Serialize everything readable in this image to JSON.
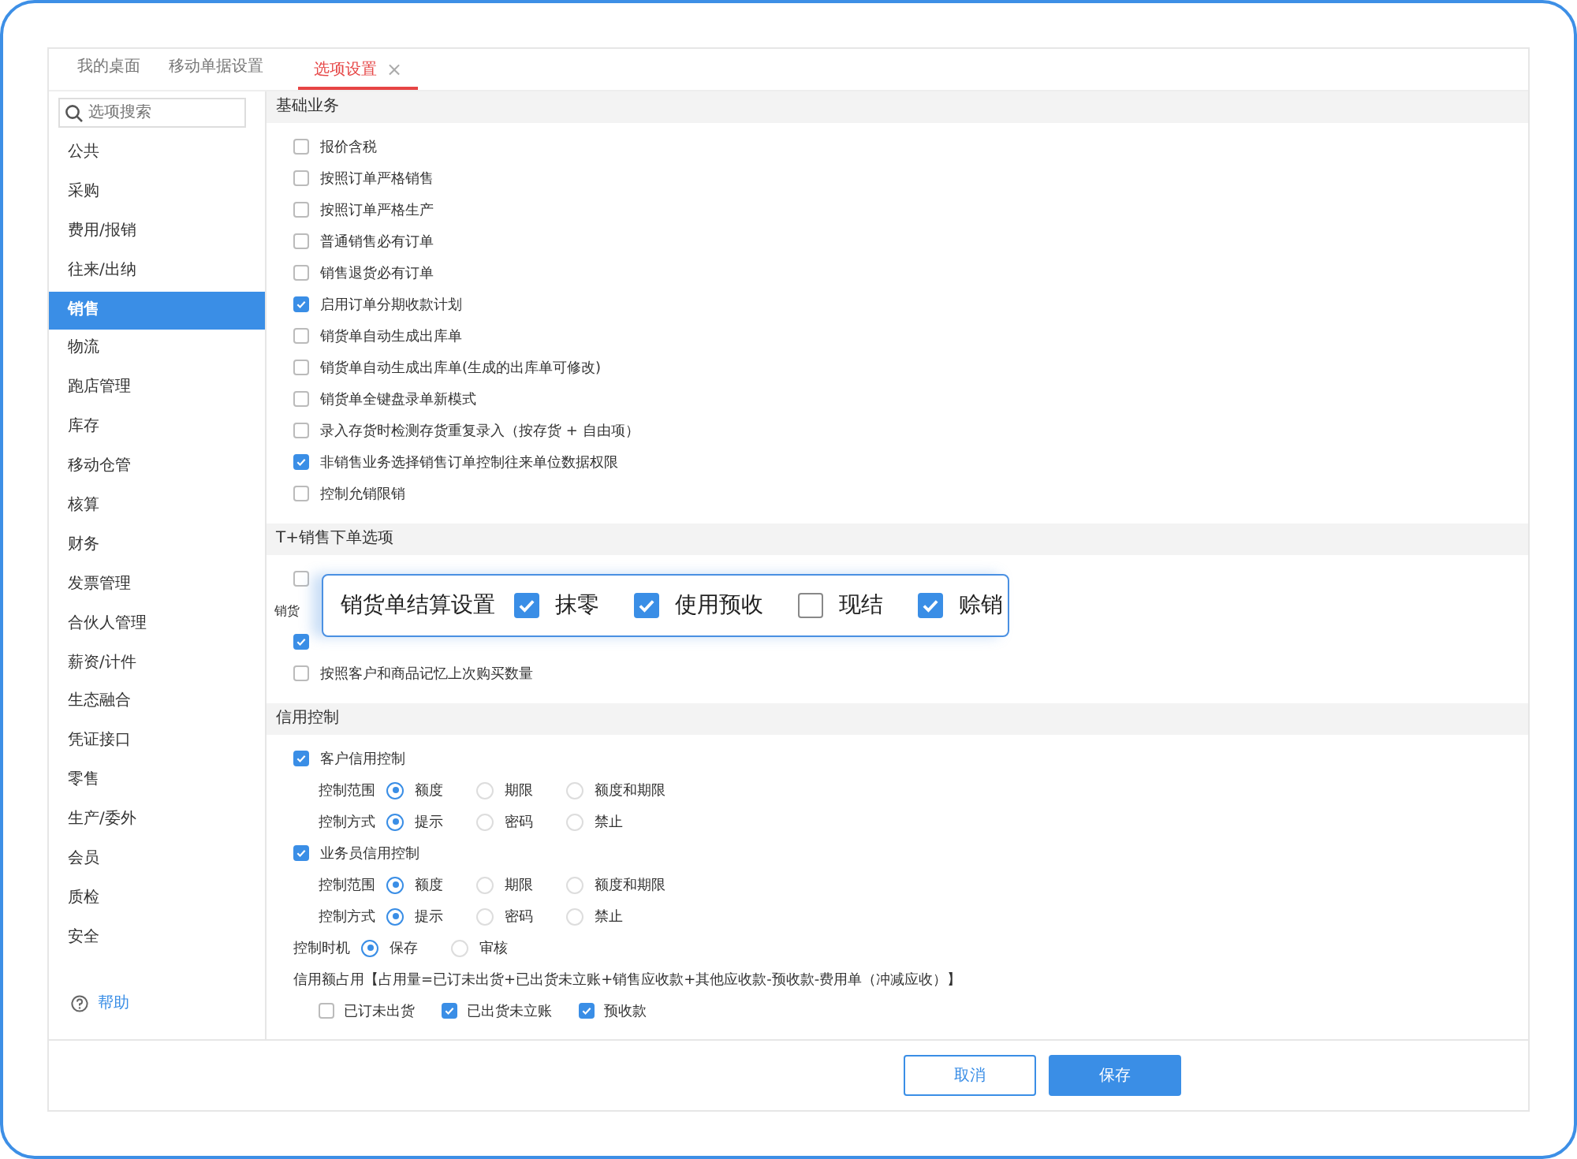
{
  "tabs": [
    {
      "label": "我的桌面",
      "selected": false
    },
    {
      "label": "移动单据设置",
      "selected": false
    },
    {
      "label": "选项设置",
      "selected": true,
      "close": "×"
    }
  ],
  "search": {
    "placeholder": "选项搜索"
  },
  "sidebar": {
    "items": [
      {
        "label": "公共",
        "selected": false
      },
      {
        "label": "采购",
        "selected": false
      },
      {
        "label": "费用/报销",
        "selected": false
      },
      {
        "label": "往来/出纳",
        "selected": false
      },
      {
        "label": "销售",
        "selected": true
      },
      {
        "label": "物流",
        "selected": false
      },
      {
        "label": "跑店管理",
        "selected": false
      },
      {
        "label": "库存",
        "selected": false
      },
      {
        "label": "移动仓管",
        "selected": false
      },
      {
        "label": "核算",
        "selected": false
      },
      {
        "label": "财务",
        "selected": false
      },
      {
        "label": "发票管理",
        "selected": false
      },
      {
        "label": "合伙人管理",
        "selected": false
      },
      {
        "label": "薪资/计件",
        "selected": false
      },
      {
        "label": "生态融合",
        "selected": false
      },
      {
        "label": "凭证接口",
        "selected": false
      },
      {
        "label": "零售",
        "selected": false
      },
      {
        "label": "生产/委外",
        "selected": false
      },
      {
        "label": "会员",
        "selected": false
      },
      {
        "label": "质检",
        "selected": false
      },
      {
        "label": "安全",
        "selected": false
      }
    ],
    "help": "帮助"
  },
  "sections": [
    {
      "title": "基础业务",
      "rows": [
        {
          "kind": "checkbox",
          "label": "报价含税",
          "checked": false
        },
        {
          "kind": "checkbox",
          "label": "按照订单严格销售",
          "checked": false
        },
        {
          "kind": "checkbox",
          "label": "按照订单严格生产",
          "checked": false
        },
        {
          "kind": "checkbox",
          "label": "普通销售必有订单",
          "checked": false
        },
        {
          "kind": "checkbox",
          "label": "销售退货必有订单",
          "checked": false
        },
        {
          "kind": "checkbox",
          "label": "启用订单分期收款计划",
          "checked": true
        },
        {
          "kind": "checkbox",
          "label": "销货单自动生成出库单",
          "checked": false
        },
        {
          "kind": "checkbox",
          "label": "销货单自动生成出库单(生成的出库单可修改)",
          "checked": false
        },
        {
          "kind": "checkbox",
          "label": "销货单全键盘录单新模式",
          "checked": false
        },
        {
          "kind": "checkbox",
          "label": "录入存货时检测存货重复录入（按存货 + 自由项）",
          "checked": false
        },
        {
          "kind": "checkbox",
          "label": "非销售业务选择销售订单控制往来单位数据权限",
          "checked": true
        },
        {
          "kind": "checkbox",
          "label": "控制允销限销",
          "checked": false
        }
      ]
    },
    {
      "title": "T+销售下单选项",
      "rows": [
        {
          "kind": "checkbox",
          "checked": false
        },
        {
          "kind": "text",
          "label": "销货"
        },
        {
          "kind": "checkbox",
          "checked": true
        },
        {
          "kind": "checkbox",
          "label": "按照客户和商品记忆上次购买数量",
          "checked": false
        }
      ]
    },
    {
      "title": "信用控制",
      "rows": [
        {
          "kind": "checkbox",
          "label": "客户信用控制",
          "checked": true
        },
        {
          "kind": "sub_radio_group",
          "label": "控制范围",
          "options": [
            {
              "label": "额度",
              "selected": true
            },
            {
              "label": "期限",
              "selected": false
            },
            {
              "label": "额度和期限",
              "selected": false
            }
          ]
        },
        {
          "kind": "sub_radio_group",
          "label": "控制方式",
          "options": [
            {
              "label": "提示",
              "selected": true
            },
            {
              "label": "密码",
              "selected": false
            },
            {
              "label": "禁止",
              "selected": false
            }
          ]
        },
        {
          "kind": "checkbox",
          "label": "业务员信用控制",
          "checked": true
        },
        {
          "kind": "sub_radio_group",
          "label": "控制范围",
          "options": [
            {
              "label": "额度",
              "selected": true
            },
            {
              "label": "期限",
              "selected": false
            },
            {
              "label": "额度和期限",
              "selected": false
            }
          ]
        },
        {
          "kind": "sub_radio_group",
          "label": "控制方式",
          "options": [
            {
              "label": "提示",
              "selected": true
            },
            {
              "label": "密码",
              "selected": false
            },
            {
              "label": "禁止",
              "selected": false
            }
          ]
        },
        {
          "kind": "radio_group",
          "label": "控制时机",
          "options": [
            {
              "label": "保存",
              "selected": true
            },
            {
              "label": "审核",
              "selected": false
            }
          ]
        },
        {
          "kind": "text",
          "label": "信用额占用【占用量=已订未出货+已出货未立账+销售应收款+其他应收款-预收款-费用单（冲减应收）】"
        },
        {
          "kind": "checkbox_group",
          "options": [
            {
              "label": "已订未出货",
              "checked": false
            },
            {
              "label": "已出货未立账",
              "checked": true
            },
            {
              "label": "预收款",
              "checked": true
            }
          ]
        }
      ]
    }
  ],
  "popup": {
    "title": "销货单结算设置",
    "options": [
      {
        "label": "抹零",
        "checked": true
      },
      {
        "label": "使用预收",
        "checked": true
      },
      {
        "label": "现结",
        "checked": false
      },
      {
        "label": "赊销",
        "checked": true
      }
    ]
  },
  "buttons": [
    {
      "label": "取消",
      "kind": "secondary"
    },
    {
      "label": "保存",
      "kind": "primary"
    }
  ]
}
